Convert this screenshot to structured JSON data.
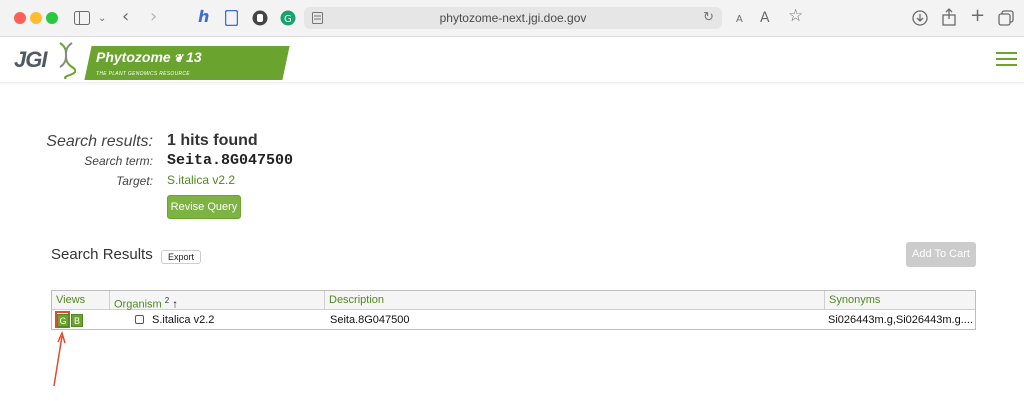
{
  "browser": {
    "url": "phytozome-next.jgi.doe.gov",
    "reader_small": "A",
    "reader_large": "A"
  },
  "site": {
    "logo_text": "JGI",
    "banner_title": "Phytozome",
    "banner_version": "13",
    "banner_subtitle": "THE PLANT GENOMICS RESOURCE",
    "brand_color": "#6aa32e"
  },
  "summary": {
    "results_label": "Search results:",
    "hits_text": "1 hits found",
    "term_label": "Search term:",
    "term_value": "Seita.8G047500",
    "target_label": "Target:",
    "target_value": "S.italica v2.2",
    "revise_button": "Revise Query"
  },
  "results": {
    "title": "Search Results",
    "export_button": "Export",
    "add_to_cart_button": "Add To Cart",
    "columns": {
      "views": "Views",
      "organism": "Organism",
      "organism_sort_index": "2",
      "organism_sort_arrow": "↑",
      "description": "Description",
      "synonyms": "Synonyms"
    },
    "rows": [
      {
        "view_g": "G",
        "view_b": "B",
        "organism": "S.italica v2.2",
        "description": "Seita.8G047500",
        "synonyms": "Si026443m.g,Si026443m.g...."
      }
    ]
  }
}
